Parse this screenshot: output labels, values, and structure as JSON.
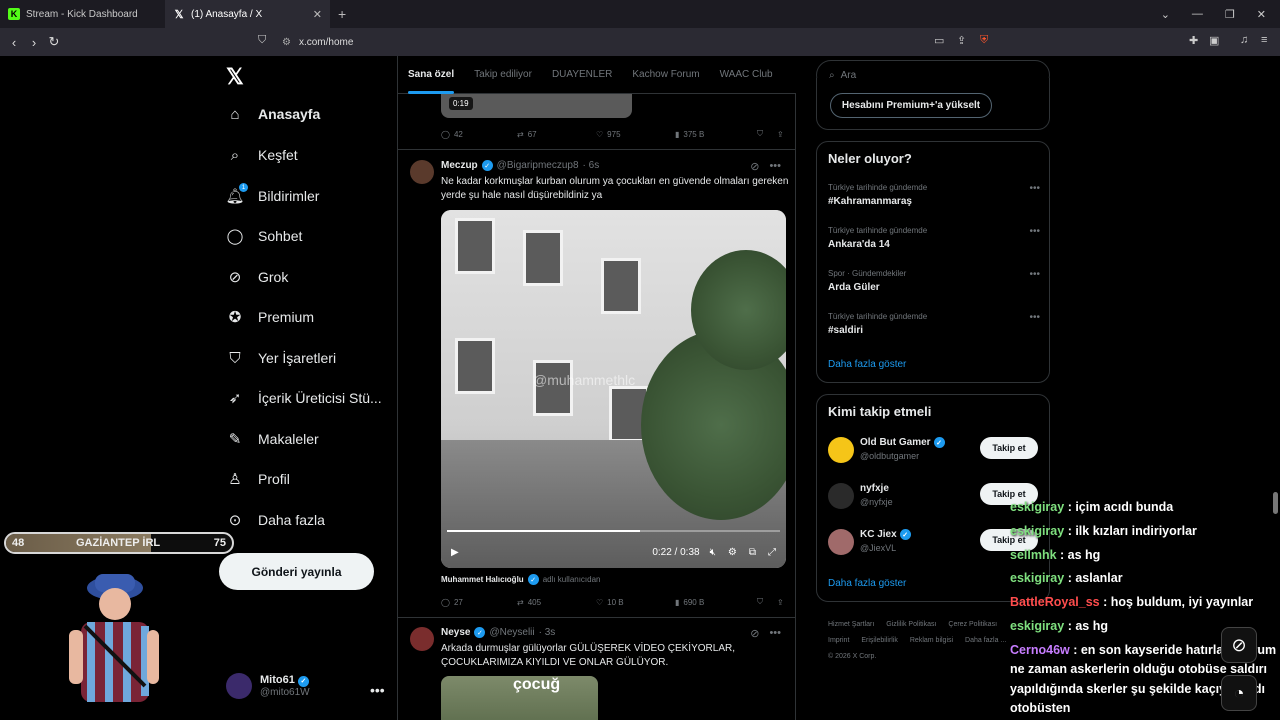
{
  "browser": {
    "tabs": [
      {
        "title": "Stream - Kick Dashboard",
        "icon": "kick-favicon",
        "active": false
      },
      {
        "title": "(1) Anasayfa / X",
        "icon": "x-favicon",
        "active": true
      }
    ],
    "url": "x.com/home"
  },
  "sidebar": {
    "items": [
      {
        "label": "Anasayfa",
        "icon": "home-icon"
      },
      {
        "label": "Keşfet",
        "icon": "search-icon"
      },
      {
        "label": "Bildirimler",
        "icon": "bell-icon",
        "badge": "1"
      },
      {
        "label": "Sohbet",
        "icon": "chat-icon"
      },
      {
        "label": "Grok",
        "icon": "grok-icon"
      },
      {
        "label": "Premium",
        "icon": "premium-icon"
      },
      {
        "label": "Yer İşaretleri",
        "icon": "bookmark-icon"
      },
      {
        "label": "İçerik Üreticisi Stü...",
        "icon": "rocket-icon"
      },
      {
        "label": "Makaleler",
        "icon": "article-icon"
      },
      {
        "label": "Profil",
        "icon": "person-icon"
      },
      {
        "label": "Daha fazla",
        "icon": "more-circle-icon"
      }
    ],
    "post_button": "Gönderi yayınla",
    "account": {
      "name": "Mito61",
      "handle": "@mito61W"
    }
  },
  "feed": {
    "tabs": [
      "Sana özel",
      "Takip ediliyor",
      "DUAYENLER",
      "Kachow Forum",
      "WAAC Club"
    ],
    "prev_tweet": {
      "duration": "0:19",
      "stats": {
        "replies": "42",
        "reposts": "67",
        "likes": "975",
        "views": "375 B"
      }
    },
    "tweet1": {
      "name": "Meczup",
      "handle": "@Bigaripmeczup8",
      "time": "· 6s",
      "text": "Ne kadar korkmuşlar kurban olurum ya çocukları en güvende olmaları gereken yerde şu hale nasıl düşürebildiniz ya",
      "watermark": "@muhammethlc",
      "video_time": "0:22 / 0:38",
      "video_progress": 0.58,
      "credit_name": "Muhammet Halıcıoğlu",
      "credit_suffix": "adlı kullanıcıdan",
      "stats": {
        "replies": "27",
        "reposts": "405",
        "likes": "10 B",
        "views": "690 B"
      }
    },
    "tweet2": {
      "name": "Neyse",
      "handle": "@Neyselii",
      "time": "· 3s",
      "text": "Arkada durmuşlar gülüyorlar GÜLÜŞEREK VİDEO ÇEKİYORLAR, ÇOCUKLARIMIZA KIYILDI VE ONLAR GÜLÜYOR.",
      "thumb_text": "çocuğ"
    }
  },
  "right": {
    "search_placeholder": "Ara",
    "premium_button": "Hesabını Premium+'a yükselt",
    "trends_title": "Neler oluyor?",
    "trends": [
      {
        "meta": "Türkiye tarihinde gündemde",
        "topic": "#Kahramanmaraş"
      },
      {
        "meta": "Türkiye tarihinde gündemde",
        "topic": "Ankara'da 14"
      },
      {
        "meta": "Spor · Gündemdekiler",
        "topic": "Arda Güler"
      },
      {
        "meta": "Türkiye tarihinde gündemde",
        "topic": "#saldiri"
      }
    ],
    "show_more": "Daha fazla göster",
    "who_title": "Kimi takip etmeli",
    "who": [
      {
        "name": "Old But Gamer",
        "handle": "@oldbutgamer",
        "verified": true
      },
      {
        "name": "nyfxje",
        "handle": "@nyfxje",
        "verified": false
      },
      {
        "name": "KC Jiex",
        "handle": "@JiexVL",
        "verified": true
      }
    ],
    "follow_label": "Takip et",
    "who_more": "Daha fazla göster",
    "footer": [
      "Hizmet Şartları",
      "Gizlilik Politikası",
      "Çerez Politikası",
      "Imprint",
      "Erişilebilirlik",
      "Reklam bilgisi",
      "Daha fazla ...",
      "© 2026 X Corp."
    ]
  },
  "overlay": {
    "bar_left": "48",
    "bar_center": "GAZİANTEP İRL",
    "bar_right": "75",
    "bar_fill": 0.64,
    "chat": [
      {
        "user": "eskigiray",
        "color": "#7fe07f",
        "msg": "içim acıdı bunda"
      },
      {
        "user": "eskigiray",
        "color": "#7fe07f",
        "msg": "ilk kızları indiriyorlar"
      },
      {
        "user": "sellmhk",
        "color": "#7fe07f",
        "msg": "as hg"
      },
      {
        "user": "eskigiray",
        "color": "#7fe07f",
        "msg": "aslanlar"
      },
      {
        "user": "BattleRoyal_ss",
        "color": "#ff4d4d",
        "msg": "hoş buldum, iyi yayınlar"
      },
      {
        "user": "eskigiray",
        "color": "#7fe07f",
        "msg": "as hg"
      },
      {
        "user": "Cerno46w",
        "color": "#c77dff",
        "msg": "en son kayseride hatırlamıyorum ne zaman askerlerin olduğu otobüse saldırı yapıldığında skerler şu şekilde kaçıyorlardı otobüsten"
      }
    ]
  },
  "colors": {
    "accent": "#1d9bf0",
    "background": "#000000",
    "text": "#e7e9ea",
    "muted": "#71767b"
  }
}
